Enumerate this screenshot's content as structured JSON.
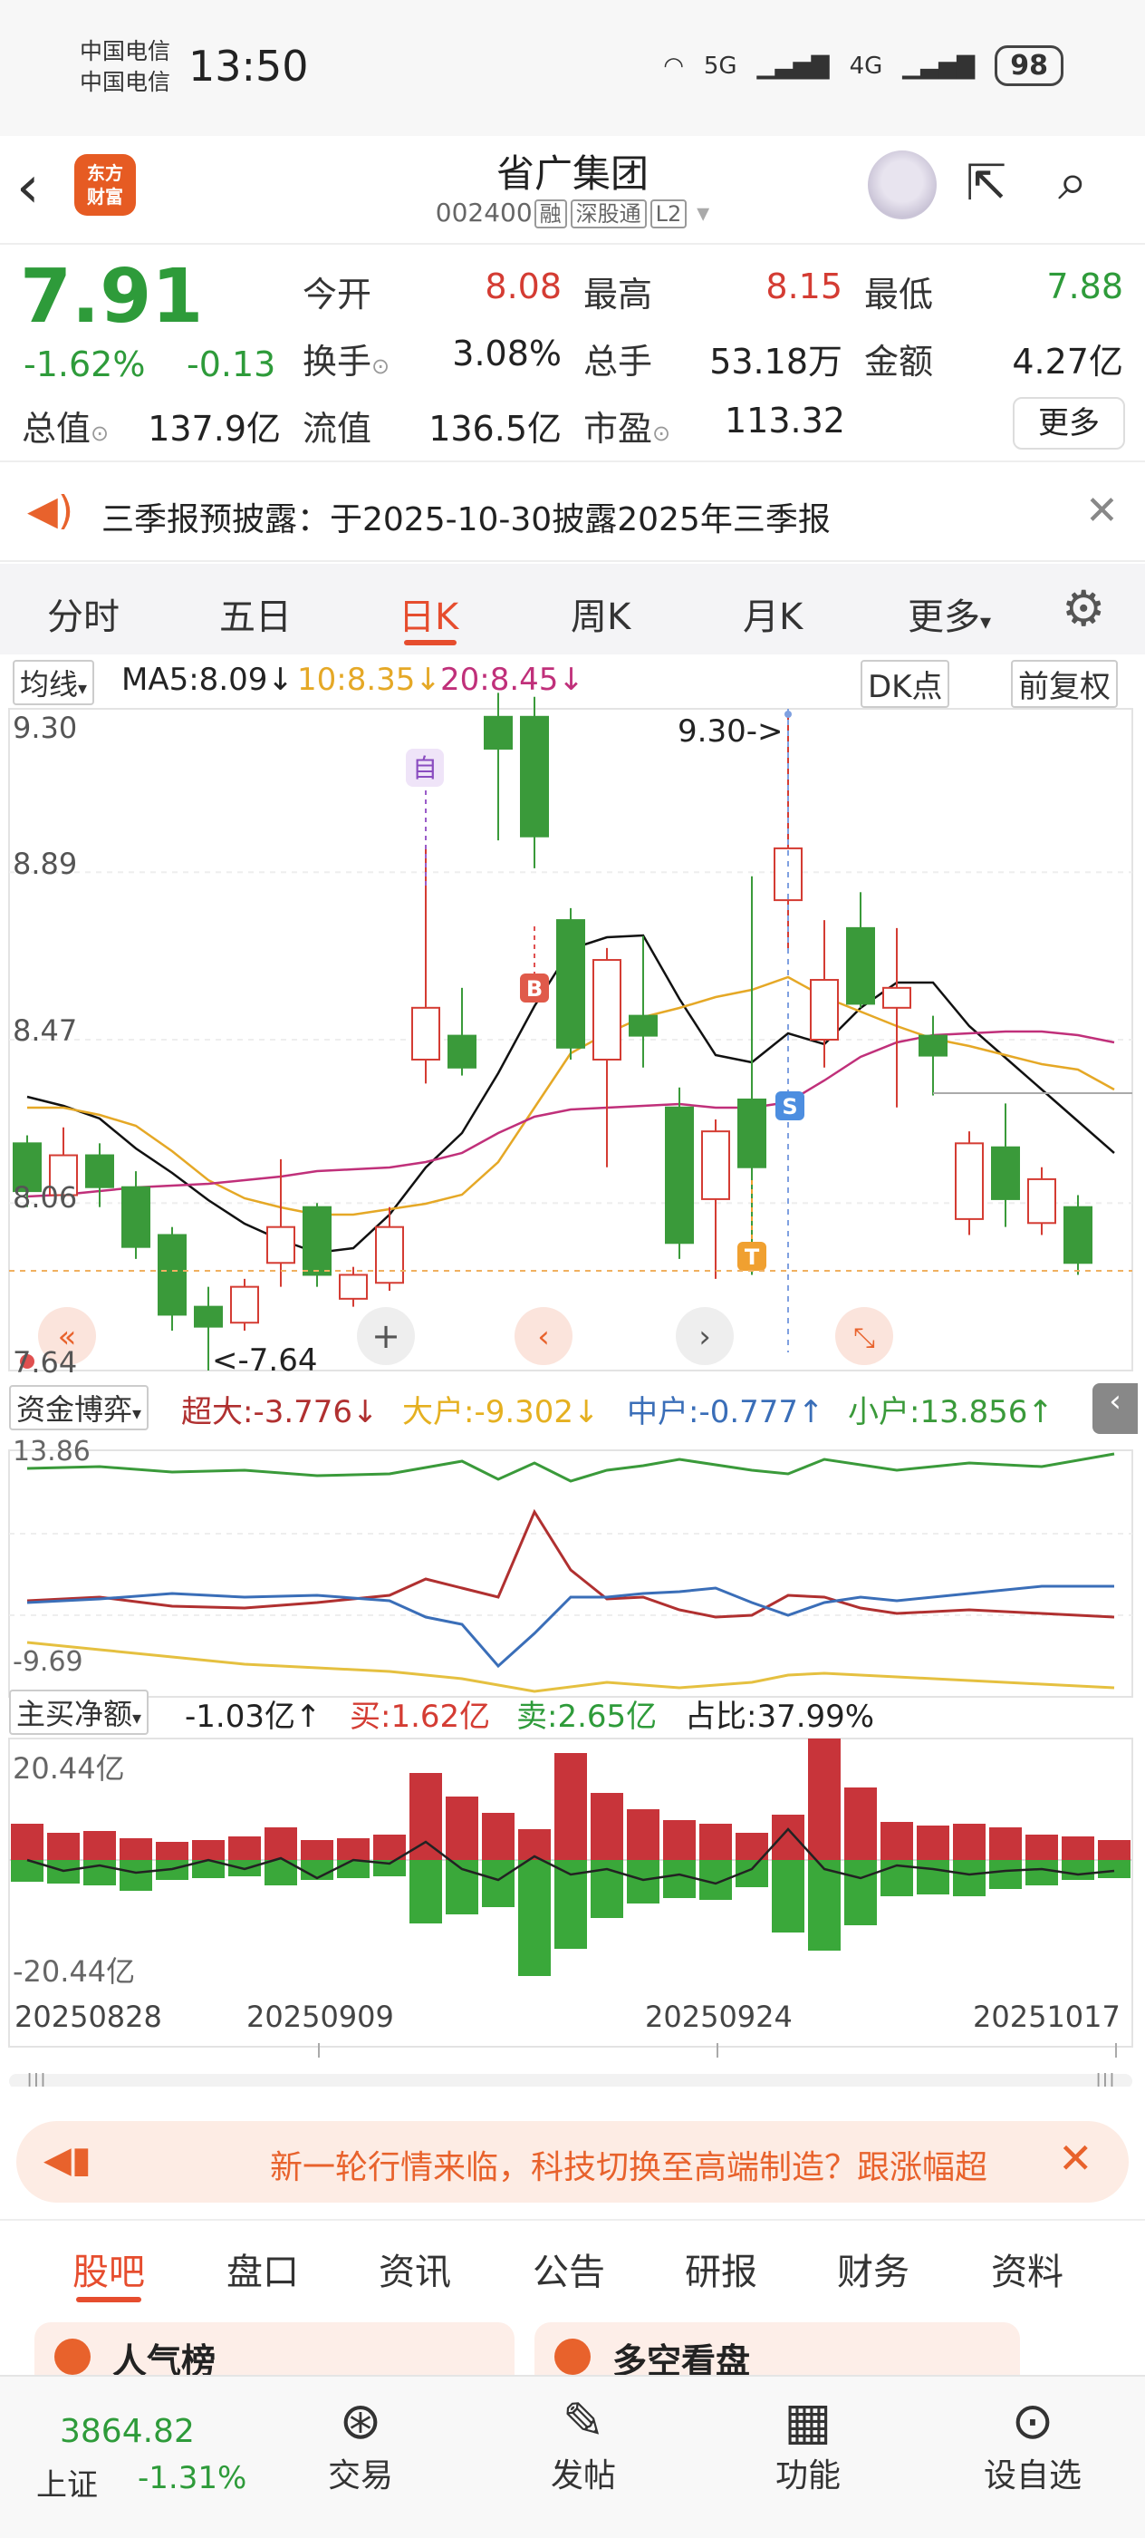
{
  "status": {
    "carrier1": "中国电信",
    "carrier2": "中国电信",
    "time": "13:50",
    "net1": "5G",
    "net2": "4G",
    "battery": "98"
  },
  "nav": {
    "name": "省广集团",
    "code": "002400",
    "tag1": "融",
    "tag2": "深股通",
    "tag3": "L2",
    "logo_line1": "东方",
    "logo_line2": "财富"
  },
  "quote": {
    "price": "7.91",
    "pct": "-1.62%",
    "chg": "-0.13",
    "open_label": "今开",
    "open": "8.08",
    "high_label": "最高",
    "high": "8.15",
    "low_label": "最低",
    "low": "7.88",
    "turnover_label": "换手",
    "turnover": "3.08%",
    "vol_label": "总手",
    "vol": "53.18万",
    "amount_label": "金额",
    "amount": "4.27亿",
    "mcap_label": "总值",
    "mcap": "137.9亿",
    "float_label": "流值",
    "float": "136.5亿",
    "pe_label": "市盈",
    "pe": "113.32",
    "more": "更多"
  },
  "notice": {
    "text": "三季报预披露：于2025-10-30披露2025年三季报"
  },
  "tabs": [
    "分时",
    "五日",
    "日K",
    "周K",
    "月K",
    "更多"
  ],
  "ma": {
    "selector": "均线",
    "ma5": "MA5:8.09↓",
    "ma10": "10:8.35↓",
    "ma20": "20:8.45↓",
    "dk": "DK点",
    "fq": "前复权"
  },
  "kline": {
    "yticks": [
      "9.30",
      "8.89",
      "8.47",
      "8.06",
      "7.64"
    ],
    "max_label": "9.30->",
    "min_label": "<-7.64",
    "mark_zi": "自",
    "mark_b": "B",
    "mark_s": "S",
    "mark_t": "T"
  },
  "flow": {
    "selector": "资金博弈",
    "super": "超大:-3.776↓",
    "big": "大户:-9.302↓",
    "mid": "中户:-0.777↑",
    "small": "小户:13.856↑",
    "ymax": "13.86",
    "ymin": "-9.69"
  },
  "net": {
    "selector": "主买净额",
    "value": "-1.03亿↑",
    "buy": "买:1.62亿",
    "sell": "卖:2.65亿",
    "ratio": "占比:37.99%",
    "ymax": "20.44亿",
    "ymin": "-20.44亿"
  },
  "dates": [
    "20250828",
    "20250909",
    "20250924",
    "20251017"
  ],
  "promo": {
    "text": "新一轮行情来临，科技切换至高端制造？跟涨幅超"
  },
  "subtabs": [
    "股吧",
    "盘口",
    "资讯",
    "公告",
    "研报",
    "财务",
    "资料"
  ],
  "cards": {
    "left": "人气榜",
    "right": "多空看盘"
  },
  "index": {
    "value": "3864.82",
    "name": "上证",
    "pct": "-1.31%"
  },
  "bottom": [
    "交易",
    "发帖",
    "功能",
    "设自选"
  ],
  "chart_data": {
    "type": "candlestick",
    "candles": [
      [
        8.21,
        8.09,
        8.23,
        8.05
      ],
      [
        8.08,
        8.18,
        8.25,
        8.07
      ],
      [
        8.18,
        8.1,
        8.21,
        8.05
      ],
      [
        8.1,
        7.95,
        8.14,
        7.92
      ],
      [
        7.98,
        7.78,
        8.0,
        7.74
      ],
      [
        7.8,
        7.75,
        7.85,
        7.64
      ],
      [
        7.76,
        7.85,
        7.87,
        7.74
      ],
      [
        7.91,
        8.0,
        8.17,
        7.85
      ],
      [
        8.05,
        7.88,
        8.06,
        7.85
      ],
      [
        7.82,
        7.88,
        7.9,
        7.8
      ],
      [
        7.86,
        8.0,
        8.05,
        7.84
      ],
      [
        8.42,
        8.55,
        8.95,
        8.36
      ],
      [
        8.48,
        8.4,
        8.6,
        8.38
      ],
      [
        9.28,
        9.2,
        9.34,
        8.97
      ],
      [
        9.28,
        8.98,
        9.33,
        8.9
      ],
      [
        8.77,
        8.45,
        8.8,
        8.42
      ],
      [
        8.42,
        8.67,
        8.7,
        8.15
      ],
      [
        8.53,
        8.48,
        8.73,
        8.4
      ],
      [
        8.3,
        7.96,
        8.35,
        7.92
      ],
      [
        8.07,
        8.24,
        8.27,
        7.87
      ],
      [
        8.32,
        8.15,
        8.88,
        7.88
      ],
      [
        8.82,
        8.95,
        9.3,
        8.69
      ],
      [
        8.47,
        8.62,
        8.77,
        8.4
      ],
      [
        8.75,
        8.56,
        8.84,
        8.55
      ],
      [
        8.55,
        8.6,
        8.75,
        8.3
      ],
      [
        8.48,
        8.43,
        8.53,
        8.33
      ],
      [
        8.02,
        8.21,
        8.24,
        7.98
      ],
      [
        8.2,
        8.07,
        8.31,
        8.0
      ],
      [
        8.01,
        8.12,
        8.15,
        7.98
      ],
      [
        8.05,
        7.91,
        8.08,
        7.88
      ]
    ]
  }
}
